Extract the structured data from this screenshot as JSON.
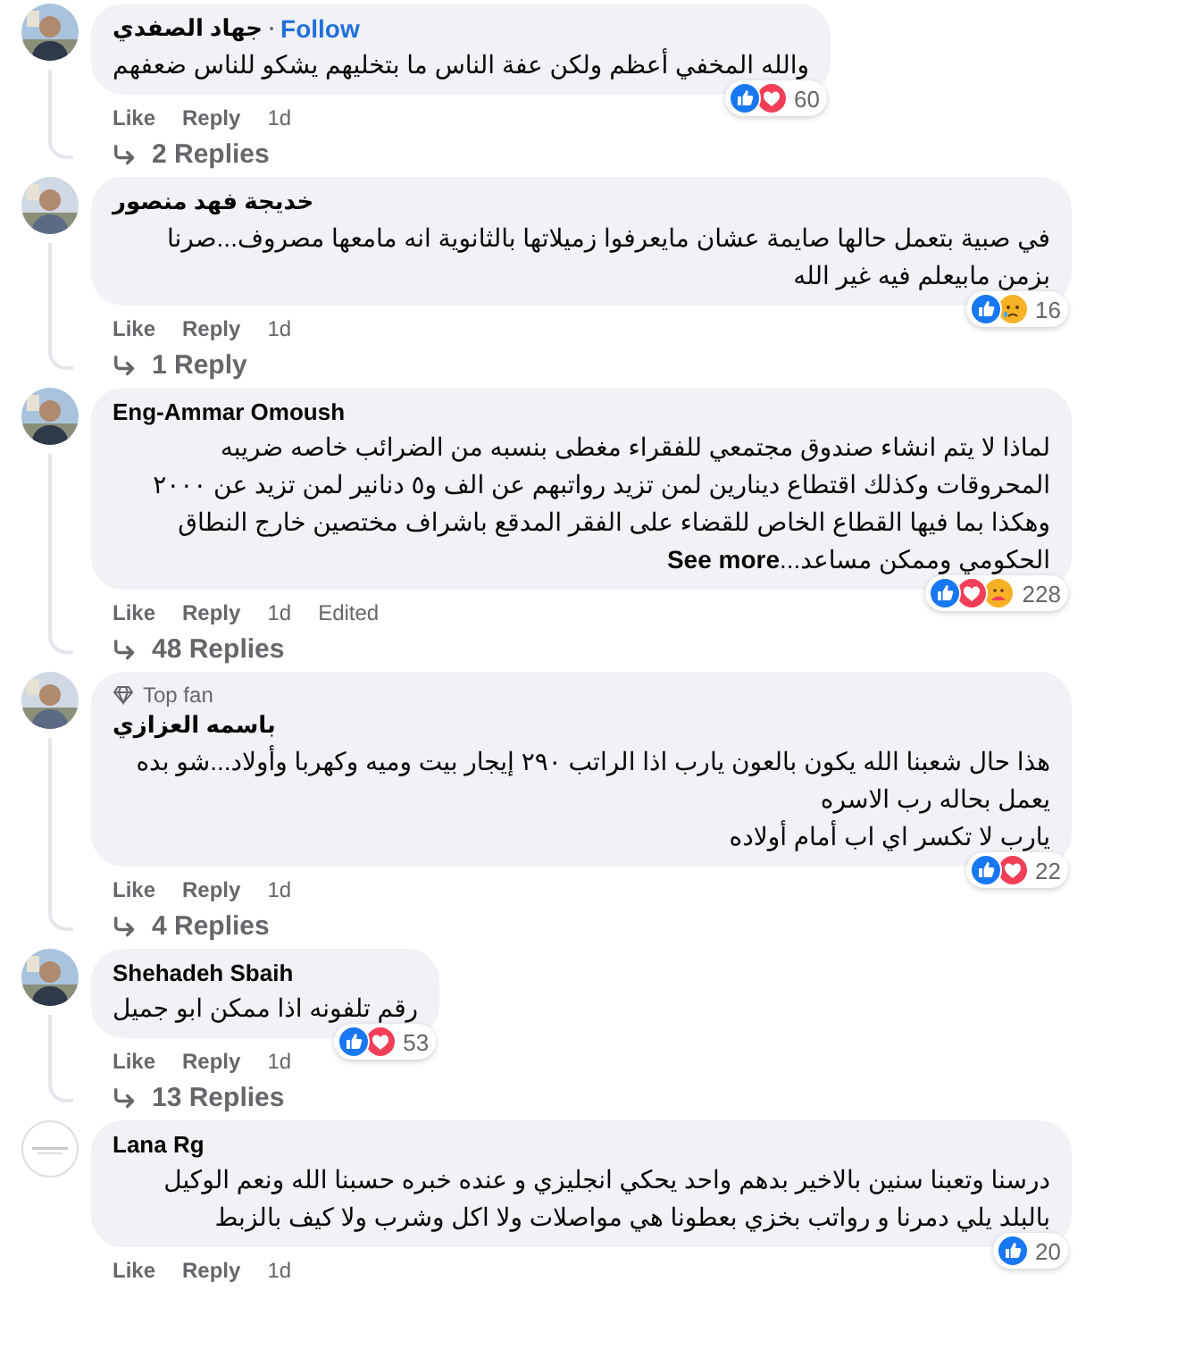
{
  "comments": [
    {
      "avatar": {
        "kind": "picture"
      },
      "name": "جهاد الصفدي",
      "follow": "Follow",
      "text": "والله المخفي أعظم ولكن عفة الناس ما بتخليهم يشكو للناس ضعفهم",
      "reactions": [
        {
          "kind": "like"
        },
        {
          "kind": "love"
        }
      ],
      "reaction_count": "60",
      "like_label": "Like",
      "reply_label": "Reply",
      "time": "1d",
      "replies": "2 Replies"
    },
    {
      "avatar": {
        "kind": "picture"
      },
      "name": "خديجة فهد منصور",
      "text": "في صبية بتعمل حالها صايمة عشان مايعرفوا زميلاتها بالثانوية انه مامعها مصروف...صرنا بزمن مابيعلم فيه غير الله",
      "reactions": [
        {
          "kind": "like"
        },
        {
          "kind": "sad"
        }
      ],
      "reaction_count": "16",
      "like_label": "Like",
      "reply_label": "Reply",
      "time": "1d",
      "replies": "1 Reply"
    },
    {
      "avatar": {
        "kind": "picture"
      },
      "name": "Eng-Ammar Omoush",
      "text": "لماذا لا يتم انشاء صندوق مجتمعي للفقراء مغطى بنسبه من الضرائب خاصه ضريبه المحروقات وكذلك اقتطاع دينارين لمن تزيد رواتبهم عن الف و٥ دنانير لمن تزيد عن ٢٠٠٠ وهكذا بما فيها القطاع الخاص للقضاء على الفقر المدقع باشراف مختصين خارج النطاق الحكومي وممكن مساعد...",
      "see_more": "See more",
      "reactions": [
        {
          "kind": "like"
        },
        {
          "kind": "love"
        },
        {
          "kind": "care"
        }
      ],
      "reaction_count": "228",
      "like_label": "Like",
      "reply_label": "Reply",
      "time": "1d",
      "edited": "Edited",
      "replies": "48 Replies"
    },
    {
      "avatar": {
        "kind": "picture"
      },
      "badge": "Top fan",
      "name": "باسمه العزازي",
      "text": "هذا حال شعبنا الله يكون بالعون يارب اذا الراتب ٢٩٠ إيجار بيت وميه وكهربا وأولاد...شو بده يعمل بحاله رب الاسره\nيارب لا تكسر اي اب أمام أولاده",
      "reactions": [
        {
          "kind": "like"
        },
        {
          "kind": "love"
        }
      ],
      "reaction_count": "22",
      "like_label": "Like",
      "reply_label": "Reply",
      "time": "1d",
      "replies": "4 Replies"
    },
    {
      "avatar": {
        "kind": "picture"
      },
      "name": "Shehadeh Sbaih",
      "text": "رقم تلفونه اذا ممكن ابو جميل",
      "reactions": [
        {
          "kind": "like"
        },
        {
          "kind": "love"
        }
      ],
      "reaction_count": "53",
      "like_label": "Like",
      "reply_label": "Reply",
      "time": "1d",
      "replies": "13 Replies"
    },
    {
      "avatar": {
        "kind": "blank"
      },
      "name": "Lana Rg",
      "text": "درسنا وتعبنا سنين بالاخير بدهم واحد يحكي انجليزي و عنده خبره حسبنا الله ونعم الوكيل بالبلد يلي دمرنا و رواتب بخزي بعطونا هي مواصلات ولا اكل وشرب ولا كيف بالزبط",
      "reactions": [
        {
          "kind": "like"
        }
      ],
      "reaction_count": "20",
      "like_label": "Like",
      "reply_label": "Reply",
      "time": "1d"
    }
  ]
}
